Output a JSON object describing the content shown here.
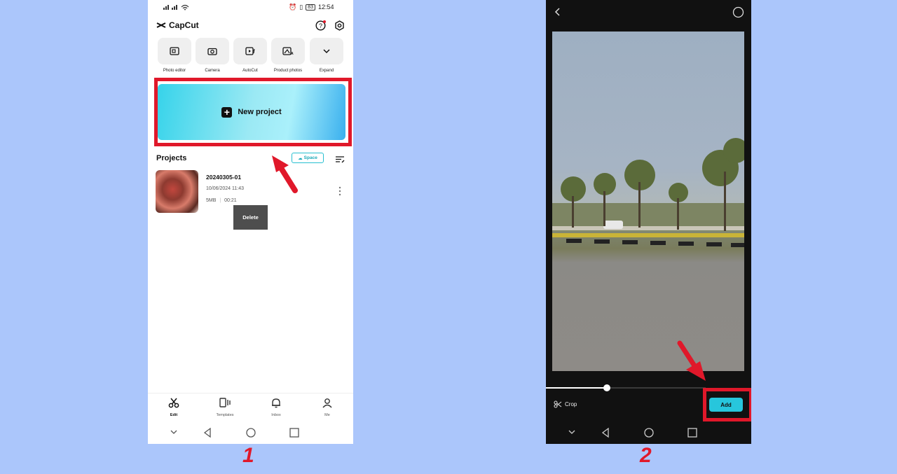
{
  "phone1": {
    "status_time": "12:54",
    "status_battery": "83",
    "app_name": "CapCut",
    "quick_actions": [
      {
        "label": "Photo editor",
        "icon": "photo-editor-icon"
      },
      {
        "label": "Camera",
        "icon": "camera-icon"
      },
      {
        "label": "AutoCut",
        "icon": "autocut-icon"
      },
      {
        "label": "Product photos",
        "icon": "product-photos-icon"
      },
      {
        "label": "Expand",
        "icon": "chevron-down-icon"
      }
    ],
    "new_project_label": "New project",
    "projects_title": "Projects",
    "space_label": "Space",
    "project": {
      "name": "20240305-01",
      "date": "10/06/2024 11:43",
      "size": "5MB",
      "duration": "00:21"
    },
    "tooltip": "Delete",
    "bottom_nav": [
      {
        "label": "Edit",
        "icon": "scissors-icon",
        "active": true
      },
      {
        "label": "Templates",
        "icon": "templates-icon",
        "active": false
      },
      {
        "label": "Inbox",
        "icon": "bell-icon",
        "active": false
      },
      {
        "label": "Me",
        "icon": "person-icon",
        "active": false
      }
    ],
    "step_number": "1"
  },
  "phone2": {
    "crop_label": "Crop",
    "add_label": "Add",
    "step_number": "2"
  },
  "colors": {
    "background": "#abc6fb",
    "highlight_red": "#e0182a",
    "accent_cyan": "#27c6dc"
  }
}
